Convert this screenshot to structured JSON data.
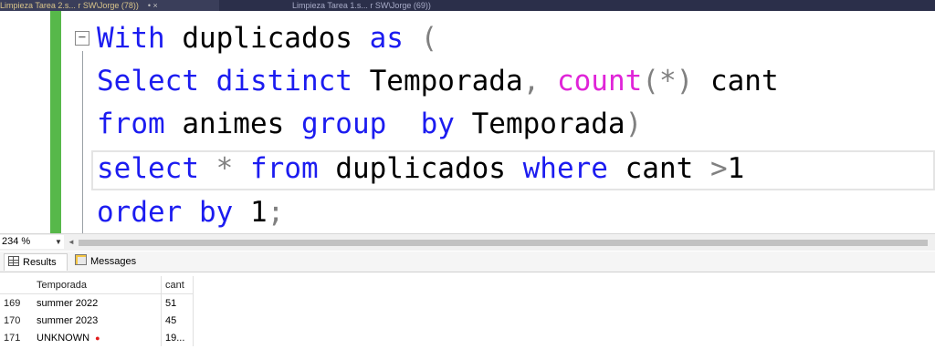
{
  "tabs": [
    {
      "label": "Limpieza Tarea 2.s... r SW\\Jorge (78))",
      "pin_label": "• ×"
    },
    {
      "label": "Limpieza Tarea 1.s... r SW\\Jorge (69))"
    }
  ],
  "editor": {
    "fold_symbol": "−",
    "lines": [
      [
        {
          "t": "With",
          "c": "kw"
        },
        {
          "t": " duplicados ",
          "c": ""
        },
        {
          "t": "as",
          "c": "kw"
        },
        {
          "t": " (",
          "c": "op"
        }
      ],
      [
        {
          "t": "Select",
          "c": "kw"
        },
        {
          "t": " ",
          "c": ""
        },
        {
          "t": "distinct",
          "c": "kw"
        },
        {
          "t": " Temporada",
          "c": ""
        },
        {
          "t": ",",
          "c": "op"
        },
        {
          "t": " ",
          "c": ""
        },
        {
          "t": "count",
          "c": "fn"
        },
        {
          "t": "(",
          "c": "op"
        },
        {
          "t": "*",
          "c": "op"
        },
        {
          "t": ")",
          "c": "op"
        },
        {
          "t": " cant",
          "c": ""
        }
      ],
      [
        {
          "t": "from",
          "c": "kw"
        },
        {
          "t": " animes ",
          "c": ""
        },
        {
          "t": "group",
          "c": "kw"
        },
        {
          "t": "  ",
          "c": ""
        },
        {
          "t": "by",
          "c": "kw"
        },
        {
          "t": " Temporada",
          "c": ""
        },
        {
          "t": ")",
          "c": "op"
        }
      ],
      [
        {
          "t": "select",
          "c": "kw"
        },
        {
          "t": " ",
          "c": ""
        },
        {
          "t": "*",
          "c": "op"
        },
        {
          "t": " ",
          "c": ""
        },
        {
          "t": "from",
          "c": "kw"
        },
        {
          "t": " duplicados ",
          "c": ""
        },
        {
          "t": "where",
          "c": "kw"
        },
        {
          "t": " cant ",
          "c": ""
        },
        {
          "t": ">",
          "c": "op"
        },
        {
          "t": "1",
          "c": ""
        }
      ],
      [
        {
          "t": "order",
          "c": "kw"
        },
        {
          "t": " ",
          "c": ""
        },
        {
          "t": "by",
          "c": "kw"
        },
        {
          "t": " 1",
          "c": ""
        },
        {
          "t": ";",
          "c": "op"
        }
      ]
    ]
  },
  "zoom": {
    "value": "234 %",
    "arrow": "▼",
    "scroll_left": "◄"
  },
  "result_tabs": {
    "results": "Results",
    "messages": "Messages"
  },
  "grid": {
    "columns": [
      "Temporada",
      "cant"
    ],
    "rows": [
      {
        "num": "169",
        "temporada": "summer 2022",
        "cant": "51",
        "flag": ""
      },
      {
        "num": "170",
        "temporada": "summer 2023",
        "cant": "45",
        "flag": ""
      },
      {
        "num": "171",
        "temporada": "UNKNOWN",
        "cant": "19...",
        "flag": "●"
      }
    ]
  },
  "colors": {
    "keyword": "#1c1cf0",
    "function": "#e024d8",
    "operator": "#808080",
    "change_bar": "#57b84a"
  }
}
